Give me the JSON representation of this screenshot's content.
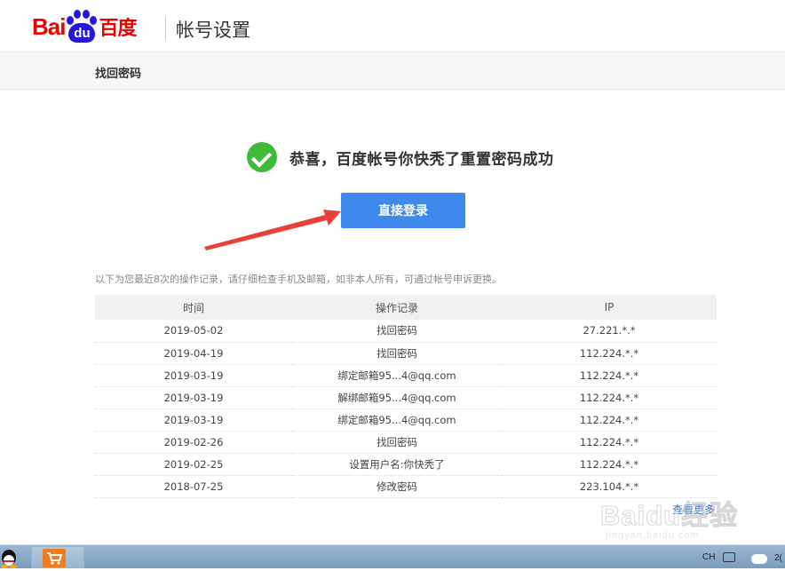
{
  "header": {
    "logo_text_left": "Bai",
    "logo_paw_text": "du",
    "logo_text_right": "百度",
    "title": "帐号设置"
  },
  "subnav": {
    "title": "找回密码"
  },
  "success": {
    "message": "恭喜，百度帐号你快秃了重置密码成功"
  },
  "actions": {
    "login_label": "直接登录"
  },
  "notice": "以下为您最近8次的操作记录，请仔细检查手机及邮箱，如非本人所有，可通过帐号申诉更换。",
  "records": {
    "headers": [
      "时间",
      "操作记录",
      "IP"
    ],
    "rows": [
      {
        "time": "2019-05-02",
        "action": "找回密码",
        "ip": "27.221.*.*"
      },
      {
        "time": "2019-04-19",
        "action": "找回密码",
        "ip": "112.224.*.*"
      },
      {
        "time": "2019-03-19",
        "action": "绑定邮箱95...4@qq.com",
        "ip": "112.224.*.*"
      },
      {
        "time": "2019-03-19",
        "action": "解绑邮箱95...4@qq.com",
        "ip": "112.224.*.*"
      },
      {
        "time": "2019-03-19",
        "action": "绑定邮箱95...4@qq.com",
        "ip": "112.224.*.*"
      },
      {
        "time": "2019-02-26",
        "action": "找回密码",
        "ip": "112.224.*.*"
      },
      {
        "time": "2019-02-25",
        "action": "设置用户名:你快秃了",
        "ip": "112.224.*.*"
      },
      {
        "time": "2018-07-25",
        "action": "修改密码",
        "ip": "223.104.*.*"
      }
    ]
  },
  "more_link": "查看更多",
  "watermark": {
    "text": "Baidu经验",
    "sub": "jingyan.baidu.com"
  },
  "taskbar": {
    "lang": "CH",
    "clock": "2("
  },
  "colors": {
    "brand_red": "#e10601",
    "brand_blue": "#2319dc",
    "button_blue": "#3f89ec",
    "success_green": "#3fba3a",
    "arrow_red": "#e8413b"
  }
}
